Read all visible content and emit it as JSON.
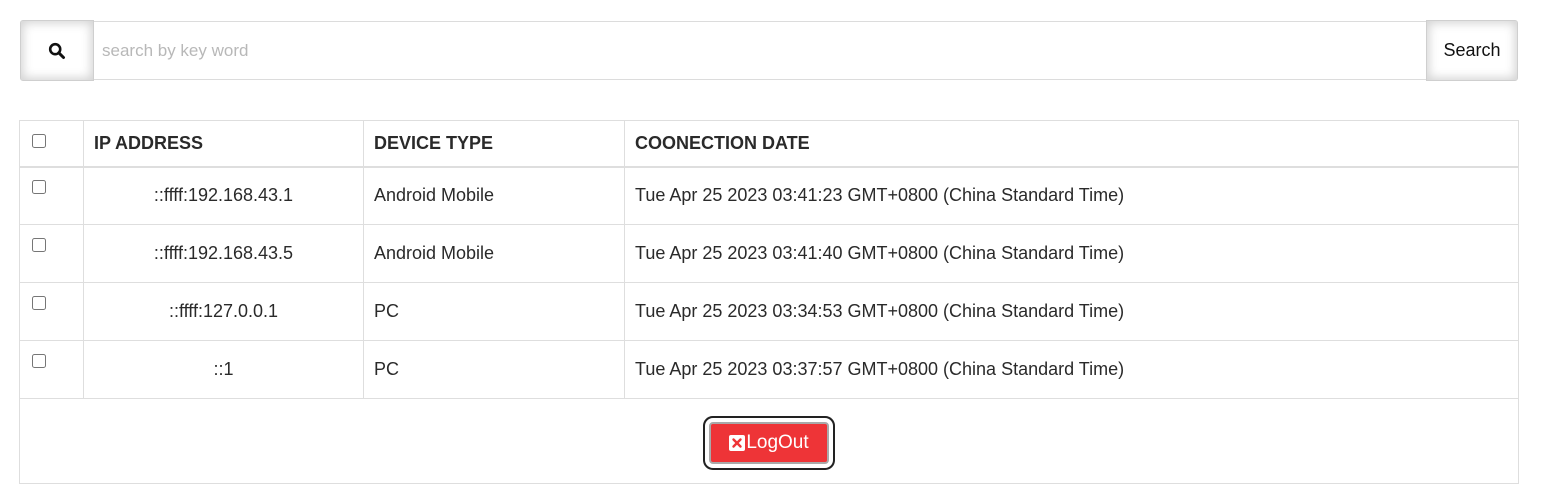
{
  "search": {
    "placeholder": "search by key word",
    "value": "",
    "button_label": "Search",
    "icon": "search-icon"
  },
  "table": {
    "headers": [
      "IP ADDRESS",
      "DEVICE TYPE",
      "COONECTION DATE"
    ],
    "rows": [
      {
        "ip": "::ffff:192.168.43.1",
        "device": "Android Mobile",
        "date": "Tue Apr 25 2023 03:41:23 GMT+0800 (China Standard Time)"
      },
      {
        "ip": "::ffff:192.168.43.5",
        "device": "Android Mobile",
        "date": "Tue Apr 25 2023 03:41:40 GMT+0800 (China Standard Time)"
      },
      {
        "ip": "::ffff:127.0.0.1",
        "device": "PC",
        "date": "Tue Apr 25 2023 03:34:53 GMT+0800 (China Standard Time)"
      },
      {
        "ip": "::1",
        "device": "PC",
        "date": "Tue Apr 25 2023 03:37:57 GMT+0800 (China Standard Time)"
      }
    ]
  },
  "logout": {
    "label": "LogOut",
    "icon": "close-icon",
    "color": "#ee3437"
  }
}
